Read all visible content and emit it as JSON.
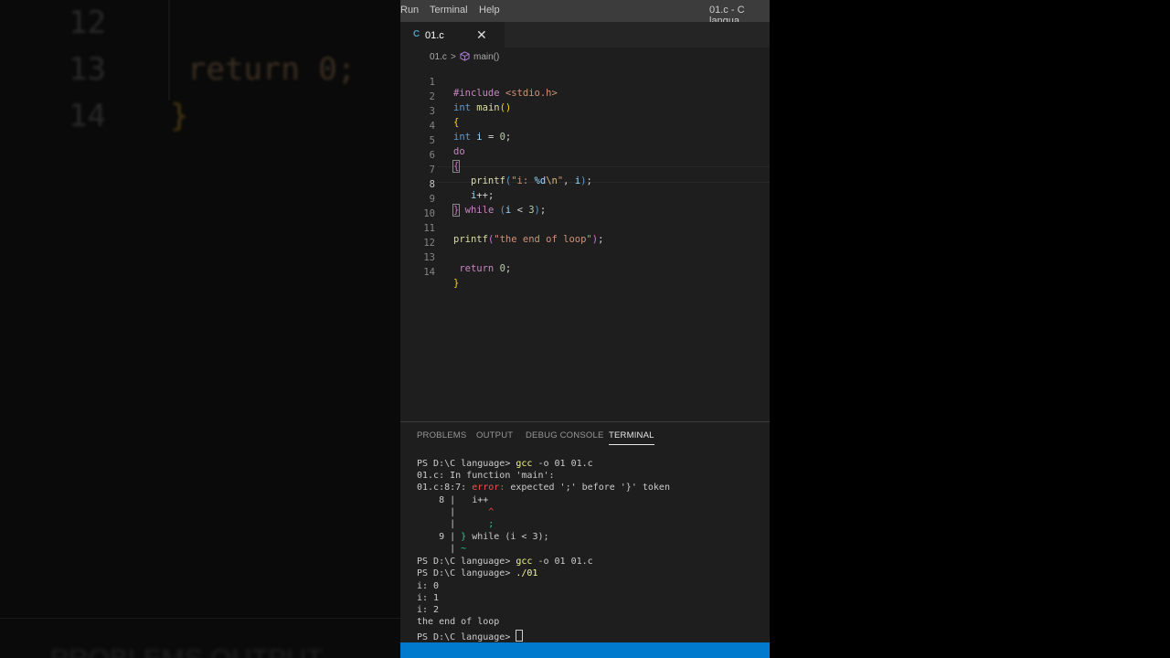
{
  "background": {
    "lines": [
      {
        "num": "12",
        "code": ""
      },
      {
        "num": "13",
        "code": "return 0;"
      },
      {
        "num": "14",
        "code": "}"
      }
    ],
    "bottom_text": "PROBLEMS     OUTPUT"
  },
  "menubar": {
    "items": [
      "Run",
      "Terminal",
      "Help"
    ],
    "title": "01.c - C langua"
  },
  "tab": {
    "icon": "C",
    "label": "01.c",
    "close": "✕"
  },
  "breadcrumb": {
    "file": "01.c",
    "separator": ">",
    "symbol": "main()"
  },
  "editor": {
    "active_line": 8,
    "lines": [
      {
        "n": "1"
      },
      {
        "n": "2"
      },
      {
        "n": "3"
      },
      {
        "n": "4"
      },
      {
        "n": "5"
      },
      {
        "n": "6"
      },
      {
        "n": "7"
      },
      {
        "n": "8"
      },
      {
        "n": "9"
      },
      {
        "n": "10"
      },
      {
        "n": "11"
      },
      {
        "n": "12"
      },
      {
        "n": "13"
      },
      {
        "n": "14"
      }
    ]
  },
  "panel": {
    "tabs": [
      "PROBLEMS",
      "OUTPUT",
      "DEBUG CONSOLE",
      "TERMINAL"
    ],
    "active_tab": "TERMINAL",
    "terminal": {
      "prompt": "PS D:\\C language> ",
      "cmd1": "gcc",
      "cmd1_args": " -o 01 01.c",
      "in_function": "01.c: In function 'main':",
      "err_loc": "01.c:8:7: ",
      "err_word": "error:",
      "err_msg": " expected ';' before '}' token",
      "src8_num": "    8 |",
      "src8_code": "   i++",
      "bar1": "      |",
      "caret": "      ^",
      "bar2": "      |",
      "semicolon": "      ;",
      "src9_num": "    9 |",
      "src9_brace": " }",
      "src9_code": " while (i < 3);",
      "bar3": "      |",
      "tilde": " ~",
      "cmd3": "./01",
      "out0": "i: 0",
      "out1": "i: 1",
      "out2": "i: 2",
      "out3": "the end of loop"
    }
  },
  "colors": {
    "statusbar": "#007acc",
    "editor_bg": "#1e1e1e",
    "menubar_bg": "#3c3c3c"
  }
}
